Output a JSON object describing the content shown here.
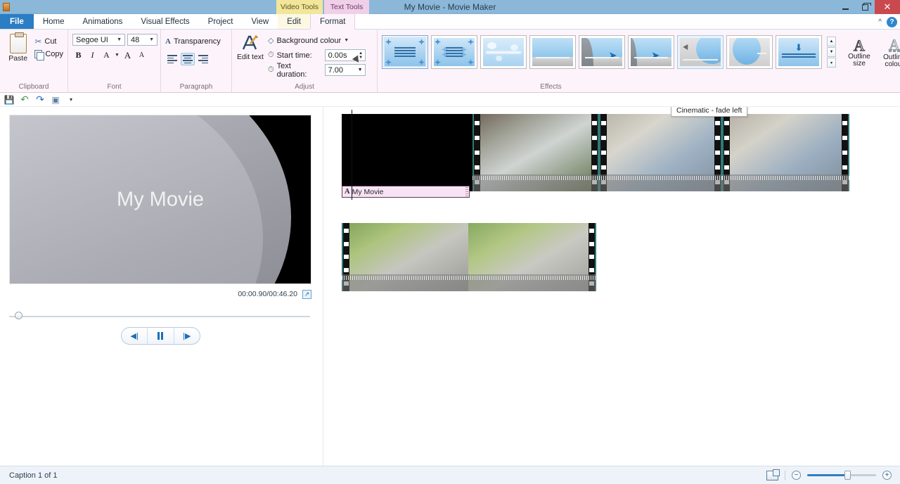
{
  "window": {
    "title": "My Movie - Movie Maker",
    "contextual_tabs": [
      {
        "label": "Video Tools",
        "color": "#f2e69a"
      },
      {
        "label": "Text Tools",
        "color": "#f0cfe9"
      }
    ],
    "controls": {
      "minimize": "minimize",
      "restore": "restore",
      "close": "✕"
    }
  },
  "ribbon": {
    "tabs": [
      {
        "label": "File",
        "kind": "file"
      },
      {
        "label": "Home",
        "kind": "normal"
      },
      {
        "label": "Animations",
        "kind": "normal"
      },
      {
        "label": "Visual Effects",
        "kind": "normal"
      },
      {
        "label": "Project",
        "kind": "normal"
      },
      {
        "label": "View",
        "kind": "normal"
      },
      {
        "label": "Edit",
        "kind": "contextual"
      },
      {
        "label": "Format",
        "kind": "active"
      }
    ],
    "collapse_icon": "chevron-up-icon",
    "help_icon": "help-icon",
    "groups": {
      "clipboard": {
        "label": "Clipboard",
        "paste": "Paste",
        "cut": "Cut",
        "copy": "Copy"
      },
      "font": {
        "label": "Font",
        "family": "Segoe UI",
        "size": "48",
        "bold": "B",
        "italic": "I",
        "font_color": "A",
        "grow": "A",
        "shrink": "A"
      },
      "paragraph": {
        "label": "Paragraph",
        "transparency": "Transparency",
        "align_left": "align-left",
        "align_center": "align-center",
        "align_right": "align-right",
        "selected_align": "align-center"
      },
      "adjust": {
        "label": "Adjust",
        "edit_text": "Edit text",
        "background_colour": "Background colour",
        "start_time_label": "Start time:",
        "start_time_value": "0.00s",
        "text_duration_label": "Text duration:",
        "text_duration_value": "7.00"
      },
      "effects": {
        "label": "Effects",
        "items": [
          {
            "name": "none",
            "style": "lines-stars",
            "selected": true
          },
          {
            "name": "sparkle",
            "style": "lines-stars-faded",
            "selected": false
          },
          {
            "name": "bokeh",
            "style": "bokeh",
            "selected": false
          },
          {
            "name": "fade-in",
            "style": "photo-plain",
            "selected": false
          },
          {
            "name": "cinematic-fade-right",
            "style": "photo-arrow-left",
            "selected": false
          },
          {
            "name": "cinematic-fade-right-2",
            "style": "photo-arrow",
            "selected": false
          },
          {
            "name": "cinematic-fade-left",
            "style": "photo-oval-cursor",
            "hovered": true,
            "selected": false
          },
          {
            "name": "cinematic-fade-oval",
            "style": "photo-oval",
            "selected": false
          },
          {
            "name": "scroll-up",
            "style": "band-downarrow",
            "selected": false
          }
        ],
        "scroll_up": "▲",
        "scroll_down": "▼",
        "more": "▾"
      },
      "outline": {
        "size_label": "Outline size",
        "colour_label": "Outline colour"
      }
    }
  },
  "quick_access": {
    "items": [
      {
        "icon": "save-icon",
        "glyph": "💾"
      },
      {
        "icon": "undo-icon",
        "glyph": "↶"
      },
      {
        "icon": "redo-icon",
        "glyph": "↷"
      },
      {
        "icon": "publish-icon",
        "glyph": "▣"
      },
      {
        "icon": "customize-qat-icon",
        "glyph": "▾"
      }
    ]
  },
  "preview": {
    "title_text": "My Movie",
    "timecode": "00:00.90/00:46.20",
    "popout_icon": "popout-icon",
    "transport": [
      {
        "name": "previous-frame",
        "glyph": "◀|"
      },
      {
        "name": "pause",
        "glyph": "pause"
      },
      {
        "name": "next-frame",
        "glyph": "|▶"
      }
    ]
  },
  "timeline": {
    "caption_clip": {
      "label": "My Movie",
      "icon": "text-a-icon"
    },
    "tooltip": "Cinematic - fade left",
    "row1_clips": [
      {
        "name": "title-clip-black",
        "kind": "black"
      },
      {
        "name": "video-clip-water",
        "kind": "video"
      },
      {
        "name": "video-clip-road-1",
        "kind": "video"
      },
      {
        "name": "video-clip-road-2",
        "kind": "video"
      }
    ],
    "row2_clips": [
      {
        "name": "video-clip-junction-1",
        "kind": "video"
      },
      {
        "name": "video-clip-junction-2",
        "kind": "video"
      }
    ]
  },
  "status": {
    "text": "Caption 1 of 1",
    "thumbnail_view_icon": "thumbnail-view-icon",
    "zoom_out": "−",
    "zoom_in": "+",
    "zoom_percent": 60
  }
}
